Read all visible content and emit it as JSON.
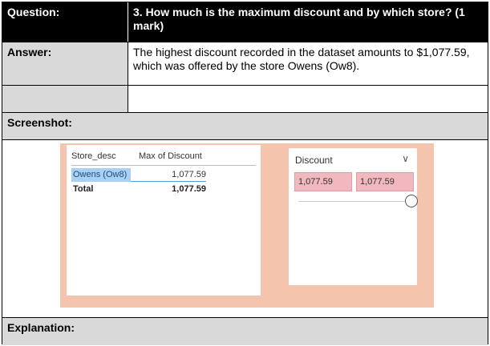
{
  "question": {
    "label": "Question:",
    "text": "3. How much is the maximum discount and by which store? (1 mark)"
  },
  "answer": {
    "label": "Answer:",
    "text": "The highest discount recorded in the dataset amounts to $1,077.59, which was offered by the store Owens (Ow8)."
  },
  "screenshot": {
    "label": "Screenshot:",
    "table": {
      "headers": [
        "Store_desc",
        "Max of Discount"
      ],
      "rows": [
        {
          "store": "Owens (Ow8)",
          "value": "1,077.59"
        }
      ],
      "total": {
        "label": "Total",
        "value": "1,077.59"
      }
    },
    "slicer": {
      "title": "Discount",
      "min": "1,077.59",
      "max": "1,077.59",
      "slider_level": 1.0
    },
    "colors": {
      "background": "#f5c4ac",
      "selected_row": "#a8d0f5",
      "slicer_box": "#f2b8bf"
    }
  },
  "explanation": {
    "label": "Explanation:"
  }
}
